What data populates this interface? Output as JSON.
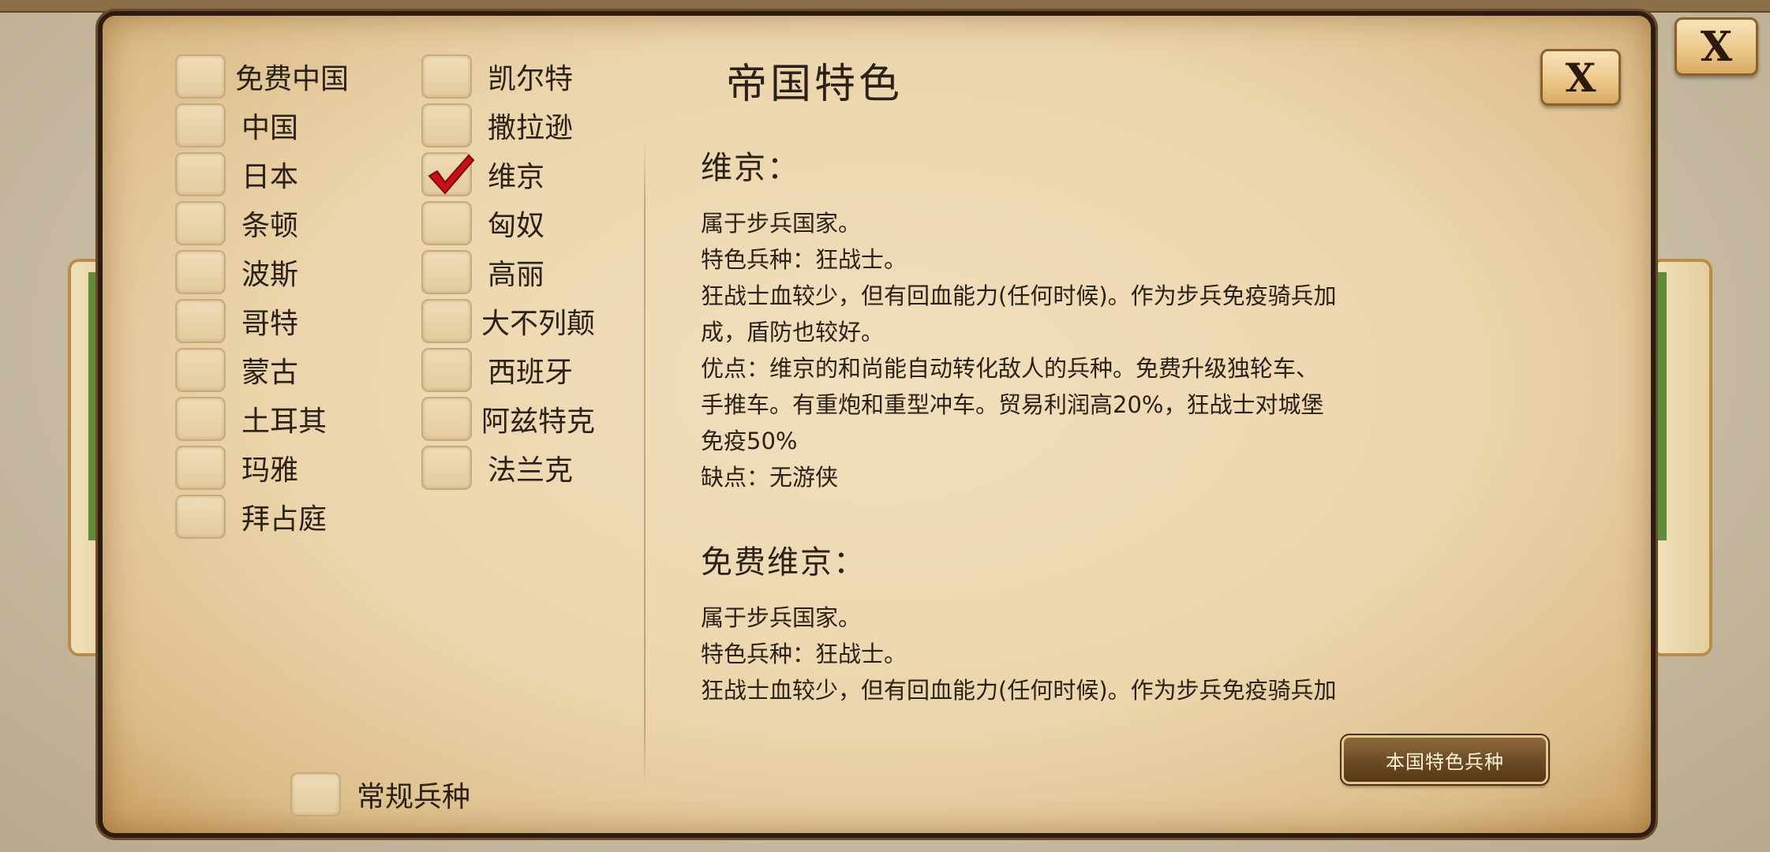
{
  "dialog": {
    "title": "帝国特色",
    "close_label": "X"
  },
  "outer_close_label": "X",
  "civilizations": {
    "left": [
      {
        "label": "免费中国",
        "checked": false
      },
      {
        "label": "中国",
        "checked": false
      },
      {
        "label": "日本",
        "checked": false
      },
      {
        "label": "条顿",
        "checked": false
      },
      {
        "label": "波斯",
        "checked": false
      },
      {
        "label": "哥特",
        "checked": false
      },
      {
        "label": "蒙古",
        "checked": false
      },
      {
        "label": "土耳其",
        "checked": false
      },
      {
        "label": "玛雅",
        "checked": false
      },
      {
        "label": "拜占庭",
        "checked": false
      }
    ],
    "right": [
      {
        "label": "凯尔特",
        "checked": false
      },
      {
        "label": "撒拉逊",
        "checked": false
      },
      {
        "label": "维京",
        "checked": true
      },
      {
        "label": "匈奴",
        "checked": false
      },
      {
        "label": "高丽",
        "checked": false
      },
      {
        "label": "大不列颠",
        "checked": false
      },
      {
        "label": "西班牙",
        "checked": false
      },
      {
        "label": "阿兹特克",
        "checked": false
      },
      {
        "label": "法兰克",
        "checked": false
      }
    ],
    "regular_units": {
      "label": "常规兵种",
      "checked": false
    }
  },
  "info": {
    "sections": [
      {
        "heading": "维京：",
        "lines": [
          "属于步兵国家。",
          "特色兵种：狂战士。",
          "狂战士血较少，但有回血能力(任何时候)。作为步兵免疫骑兵加",
          "成，盾防也较好。",
          "优点：维京的和尚能自动转化敌人的兵种。免费升级独轮车、",
          "手推车。有重炮和重型冲车。贸易利润高20%，狂战士对城堡",
          "免疫50%",
          "缺点：无游侠"
        ]
      },
      {
        "heading": "免费维京：",
        "lines": [
          "属于步兵国家。",
          "特色兵种：狂战士。",
          "狂战士血较少，但有回血能力(任何时候)。作为步兵免疫骑兵加"
        ]
      }
    ]
  },
  "own_units_button_label": "本国特色兵种",
  "colors": {
    "parchment": "#ecd5ac",
    "frame": "#2c1d10",
    "check_red": "#c8101b"
  }
}
